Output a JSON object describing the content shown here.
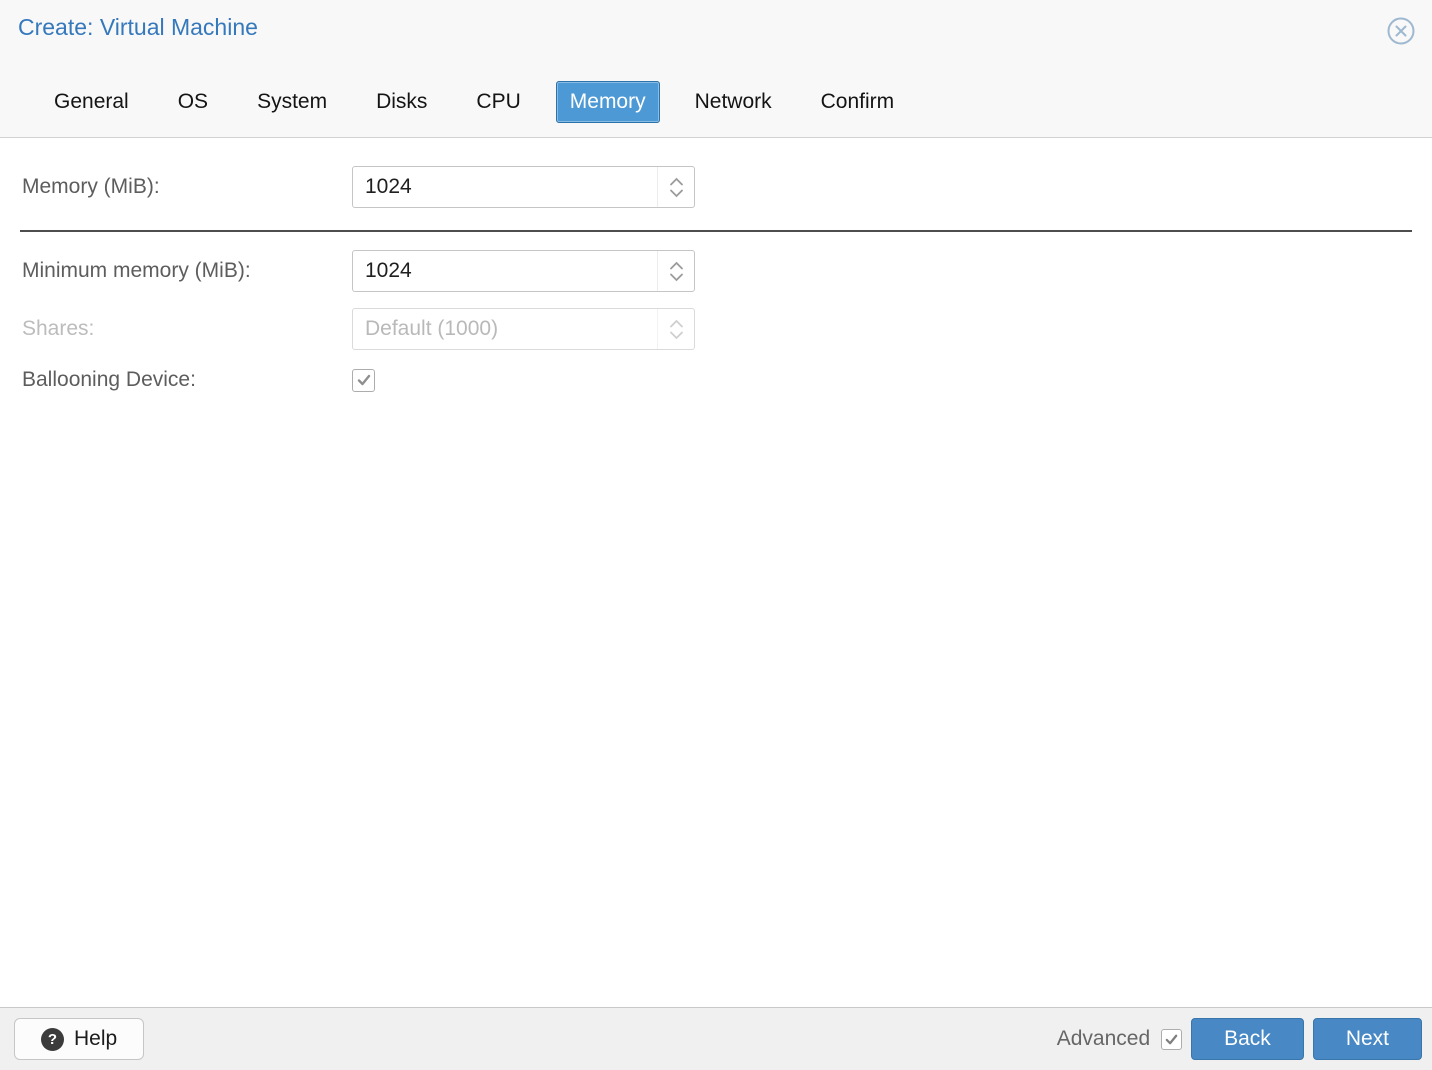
{
  "window": {
    "title": "Create: Virtual Machine"
  },
  "tabs": [
    {
      "label": "General",
      "active": false
    },
    {
      "label": "OS",
      "active": false
    },
    {
      "label": "System",
      "active": false
    },
    {
      "label": "Disks",
      "active": false
    },
    {
      "label": "CPU",
      "active": false
    },
    {
      "label": "Memory",
      "active": true
    },
    {
      "label": "Network",
      "active": false
    },
    {
      "label": "Confirm",
      "active": false
    }
  ],
  "form": {
    "memory": {
      "label": "Memory (MiB):",
      "value": "1024"
    },
    "min_memory": {
      "label": "Minimum memory (MiB):",
      "value": "1024"
    },
    "shares": {
      "label": "Shares:",
      "placeholder": "Default (1000)",
      "disabled": true
    },
    "ballooning": {
      "label": "Ballooning Device:",
      "checked": true
    }
  },
  "footer": {
    "help_label": "Help",
    "help_icon": "?",
    "advanced_label": "Advanced",
    "advanced_checked": true,
    "back_label": "Back",
    "next_label": "Next"
  },
  "colors": {
    "title_text": "#3578bc",
    "active_tab_bg": "#4d99d5",
    "active_tab_border": "#2c72aa",
    "primary_button_bg": "#4788c5",
    "divider": "#4d4d4d",
    "footer_bg": "#f0f0f0"
  }
}
